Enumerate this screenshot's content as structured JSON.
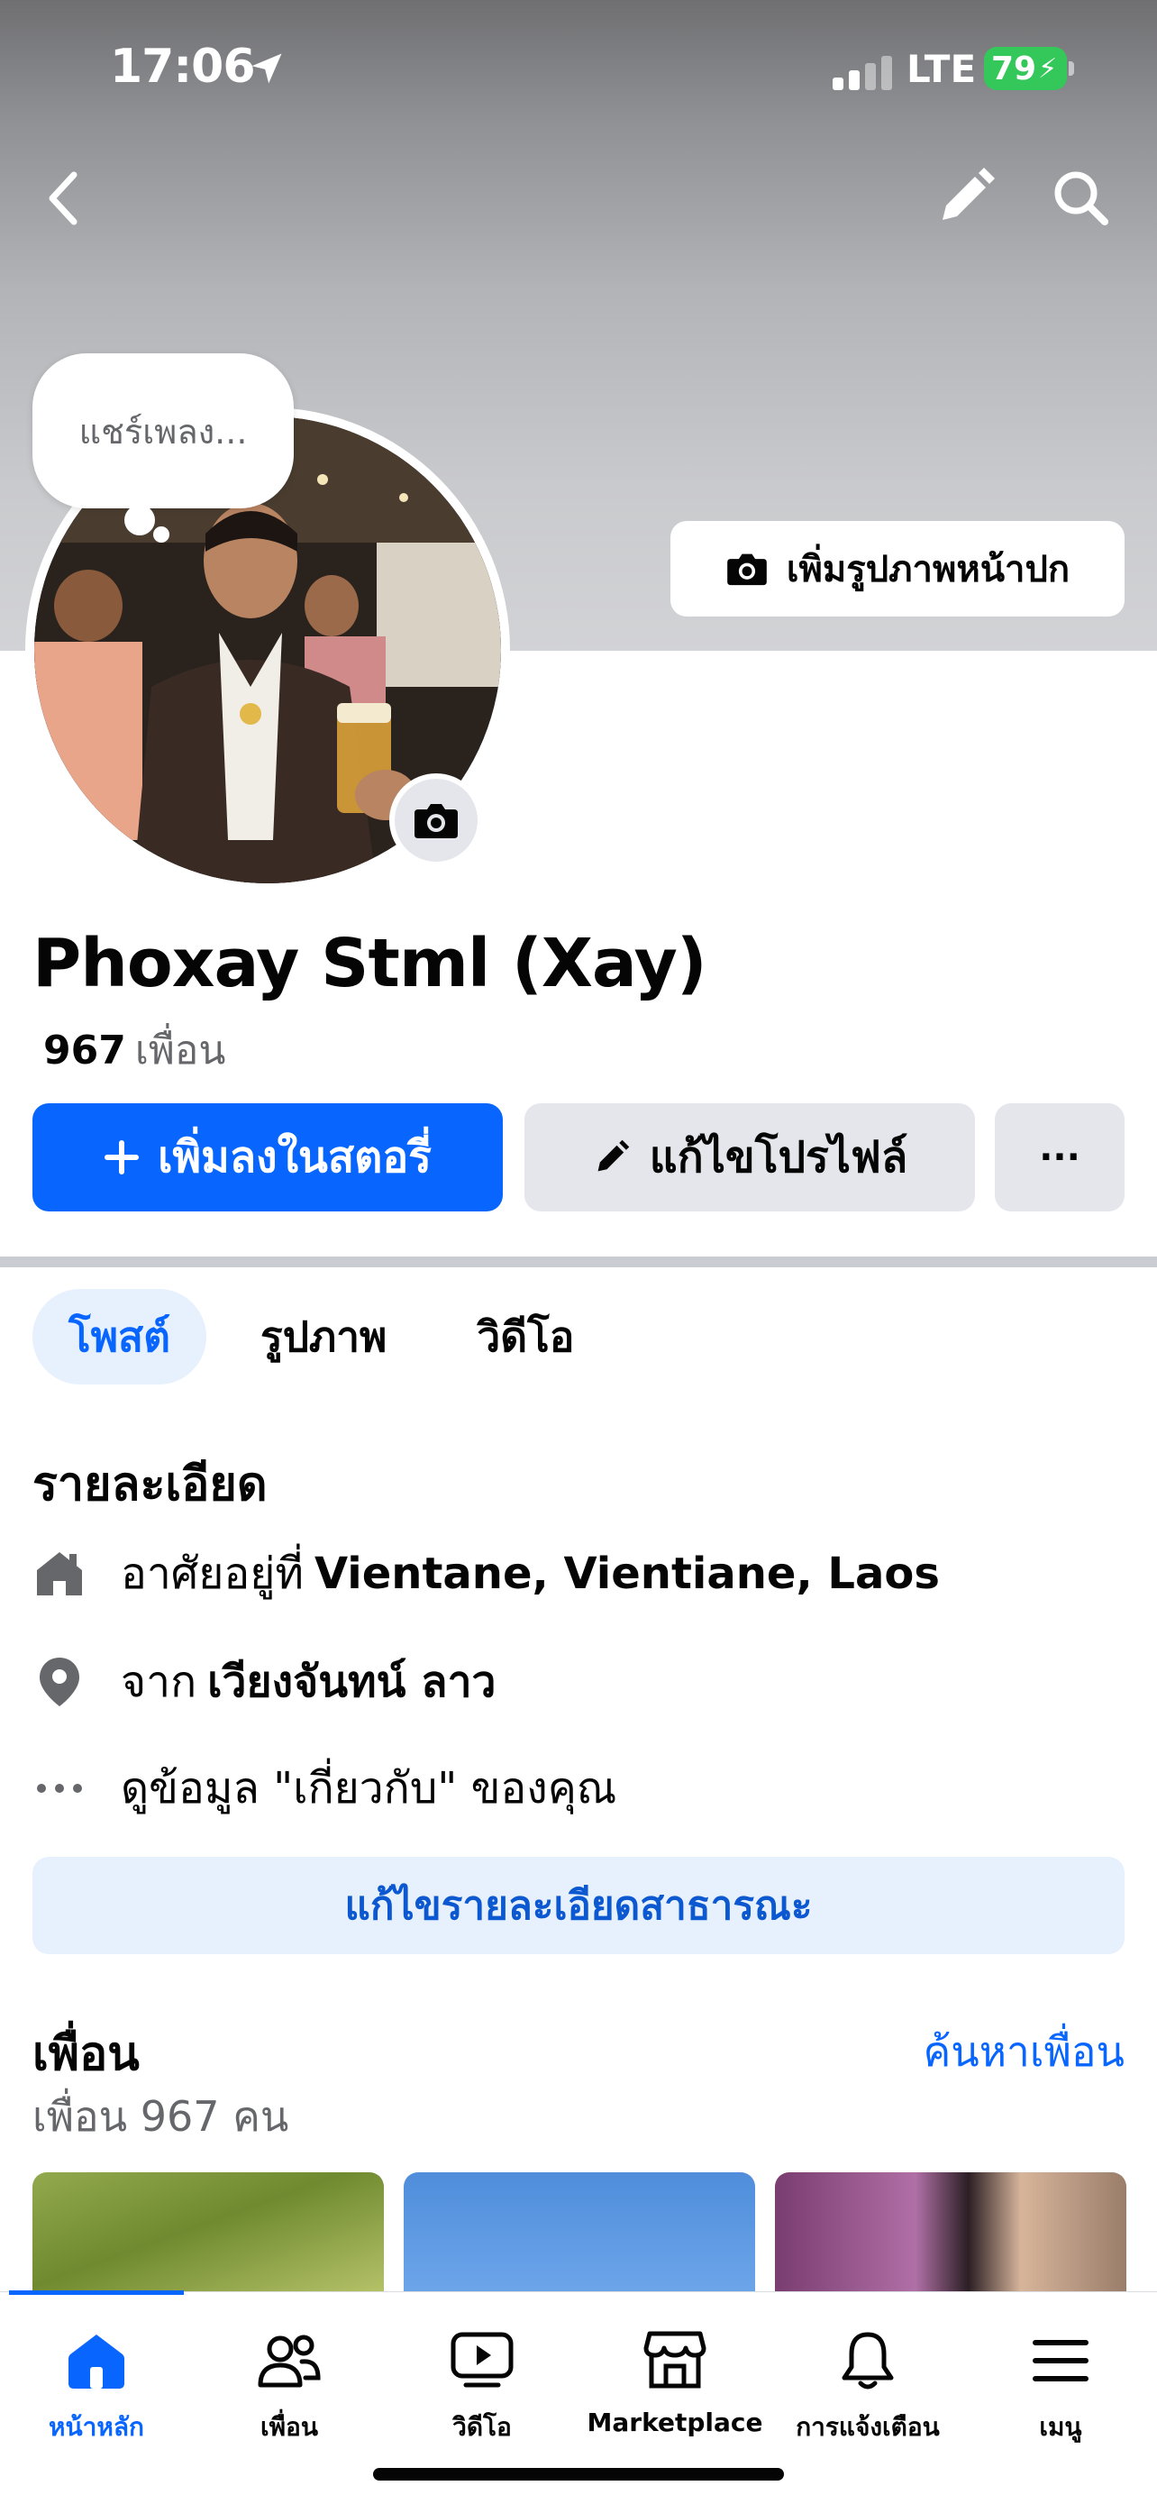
{
  "status_bar": {
    "time": "17:06",
    "network": "LTE",
    "battery": "79"
  },
  "header": {
    "note_text": "แชร์เพลง...",
    "add_cover_label": "เพิ่มรูปภาพหน้าปก"
  },
  "profile": {
    "name": "Phoxay Stml (Xay)",
    "friends_count": "967",
    "friends_label": "เพื่อน"
  },
  "actions": {
    "add_story_label": "เพิ่มลงในสตอรี่",
    "edit_profile_label": "แก้ไขโปรไฟล์",
    "more_label": "···"
  },
  "tabs": [
    {
      "label": "โพสต์",
      "active": true
    },
    {
      "label": "รูปภาพ",
      "active": false
    },
    {
      "label": "วิดีโอ",
      "active": false
    }
  ],
  "details": {
    "title": "รายละเอียด",
    "lives_in_prefix": "อาศัยอยู่ที่",
    "lives_in_value": "Vientane, Vientiane, Laos",
    "from_prefix": "จาก",
    "from_value": "เวียงจันทน์ ลาว",
    "about_text": "ดูข้อมูล \"เกี่ยวกับ\" ของคุณ",
    "edit_public_label": "แก้ไขรายละเอียดสาธารณะ"
  },
  "friends_section": {
    "title": "เพื่อน",
    "find_friends_label": "ค้นหาเพื่อน",
    "count_text": "เพื่อน 967 คน"
  },
  "bottom_nav": [
    {
      "label": "หน้าหลัก",
      "icon": "home-icon",
      "active": true
    },
    {
      "label": "เพื่อน",
      "icon": "friends-icon",
      "active": false
    },
    {
      "label": "วิดีโอ",
      "icon": "video-icon",
      "active": false
    },
    {
      "label": "Marketplace",
      "icon": "marketplace-icon",
      "active": false
    },
    {
      "label": "การแจ้งเตือน",
      "icon": "bell-icon",
      "active": false
    },
    {
      "label": "เมนู",
      "icon": "menu-icon",
      "active": false
    }
  ],
  "colors": {
    "accent": "#0866ff",
    "button_grey": "#e4e6eb",
    "tab_active_bg": "#e7f0fd",
    "text_secondary": "#65676b",
    "battery_green": "#34c759"
  }
}
